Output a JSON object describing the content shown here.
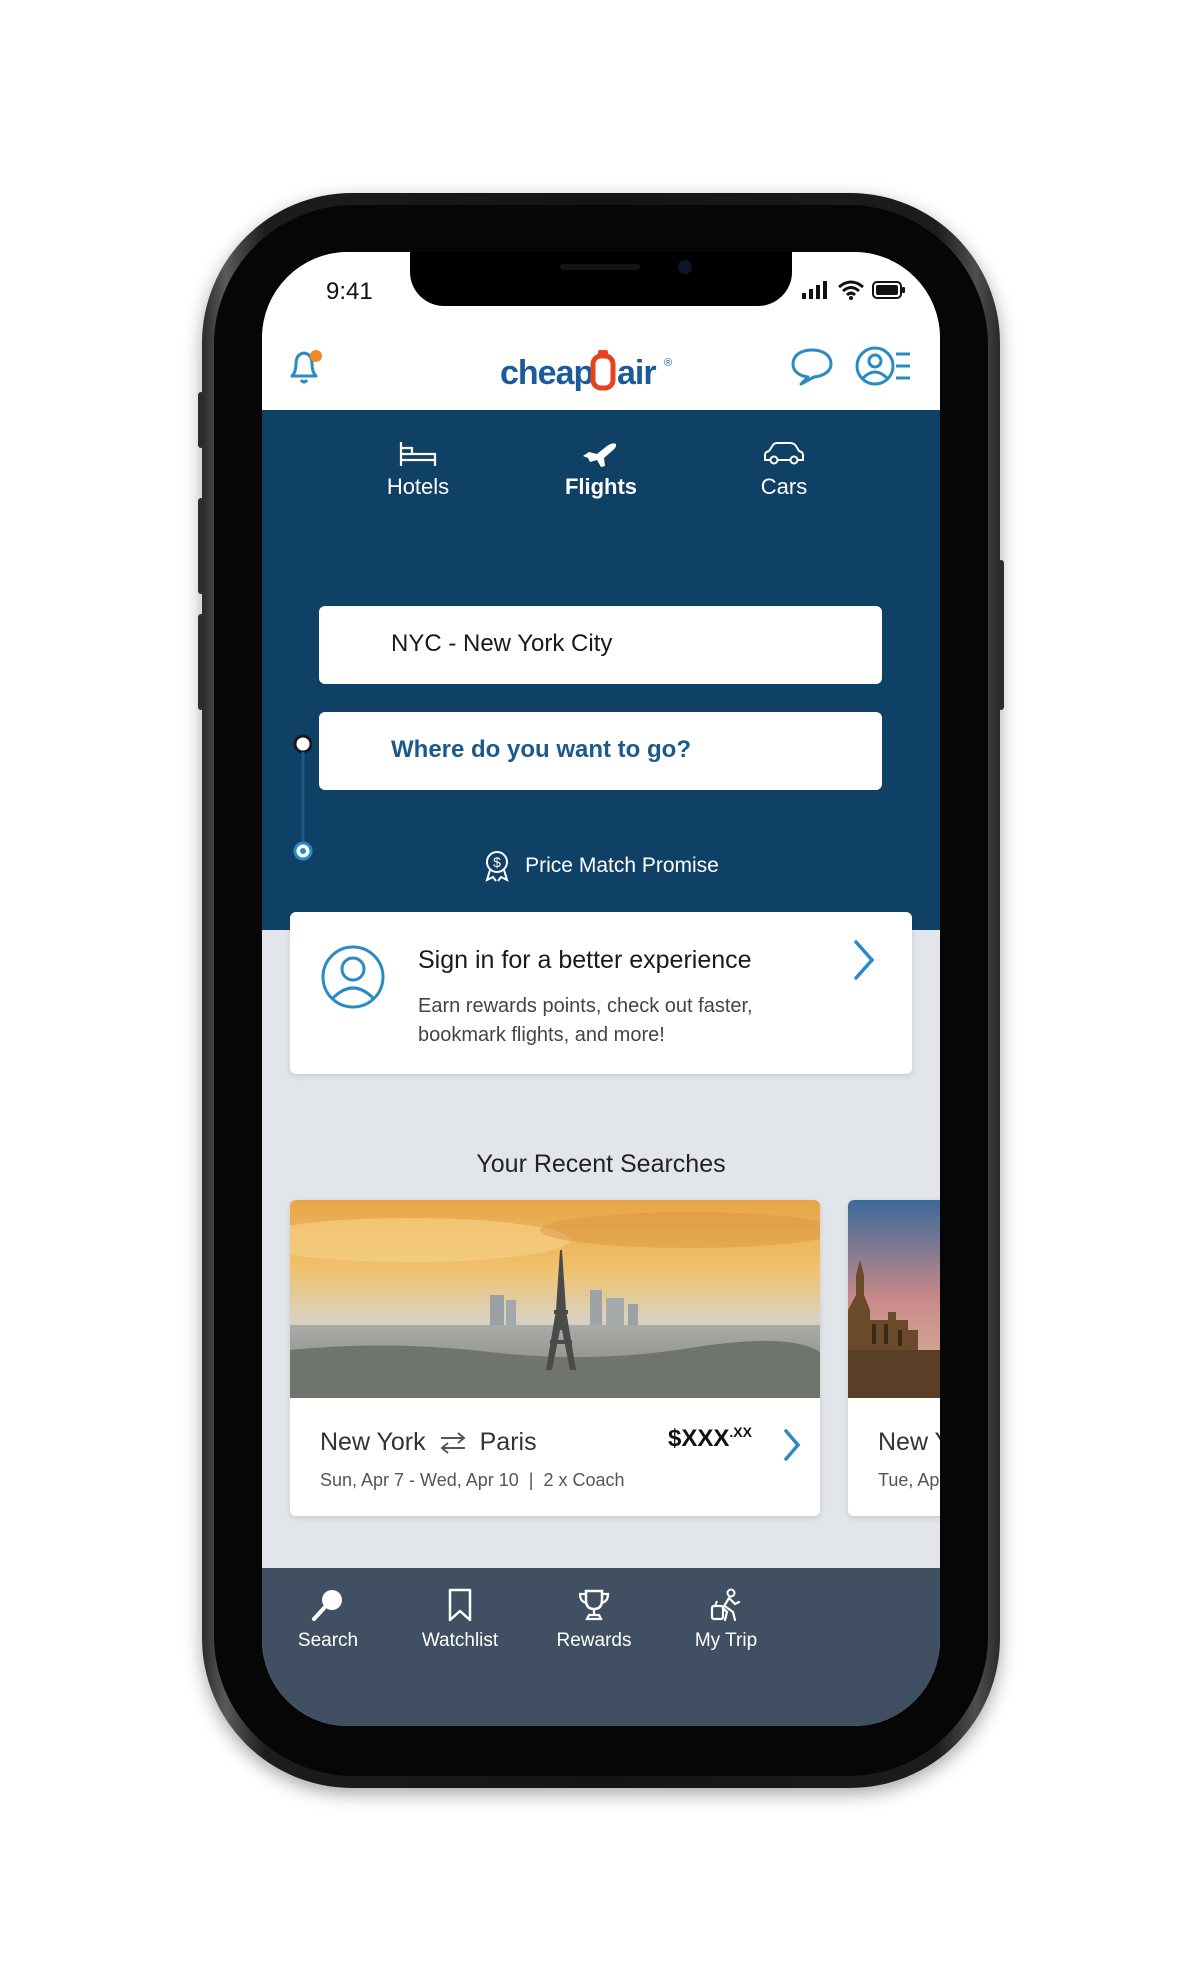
{
  "status_bar": {
    "time": "9:41"
  },
  "header": {
    "logo_text": "cheapOair",
    "logo_mark": "®"
  },
  "tabs": [
    {
      "label": "Hotels",
      "icon": "bed-icon",
      "active": false
    },
    {
      "label": "Flights",
      "icon": "plane-icon",
      "active": true
    },
    {
      "label": "Cars",
      "icon": "car-icon",
      "active": false
    }
  ],
  "search": {
    "origin_value": "NYC - New York City",
    "destination_placeholder": "Where do you want to go?"
  },
  "price_match": {
    "label": "Price Match Promise"
  },
  "signin_card": {
    "title": "Sign in for a better experience",
    "subtitle": "Earn rewards points, check out faster, bookmark flights, and more!"
  },
  "recent_searches": {
    "title": "Your Recent Searches",
    "cards": [
      {
        "from": "New York",
        "to": "Paris",
        "dates": "Sun, Apr 7 - Wed, Apr 10  |  2 x Coach",
        "price": "$XXX",
        "price_cents": ".XX"
      },
      {
        "from": "New Y",
        "dates": "Tue, Ap"
      }
    ]
  },
  "bottom_nav": [
    {
      "label": "Search",
      "icon": "search-icon"
    },
    {
      "label": "Watchlist",
      "icon": "bookmark-icon"
    },
    {
      "label": "Rewards",
      "icon": "trophy-icon"
    },
    {
      "label": "My Trip",
      "icon": "luggage-icon"
    }
  ],
  "colors": {
    "brand_blue": "#0f4066",
    "accent_orange": "#f08a24",
    "link_blue": "#2a8ac4",
    "bottom_nav": "#404f61"
  }
}
